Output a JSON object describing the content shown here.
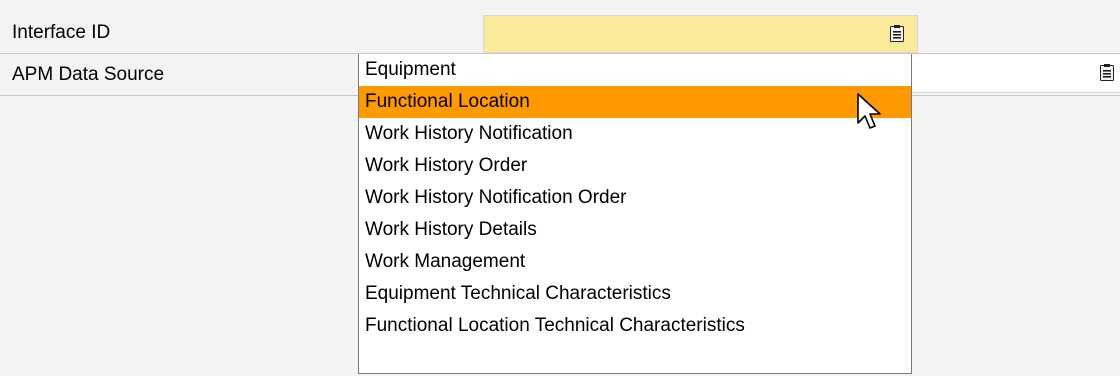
{
  "form": {
    "rows": [
      {
        "label": "Interface ID",
        "value": ""
      },
      {
        "label": "APM Data Source",
        "value": ""
      }
    ]
  },
  "dropdown": {
    "options": [
      "Equipment",
      "Functional Location",
      "Work History Notification",
      "Work History Order",
      "Work History Notification Order",
      "Work History Details",
      "Work Management",
      "Equipment Technical Characteristics",
      "Functional Location Technical Characteristics"
    ],
    "highlighted": "Functional Location"
  },
  "colors": {
    "required_field": "#fbe99a",
    "highlight": "#ff9900",
    "background": "#f3f3f3"
  },
  "icons": {
    "dropdown_button": "list-dropdown-icon",
    "cursor": "mouse-pointer-icon"
  }
}
